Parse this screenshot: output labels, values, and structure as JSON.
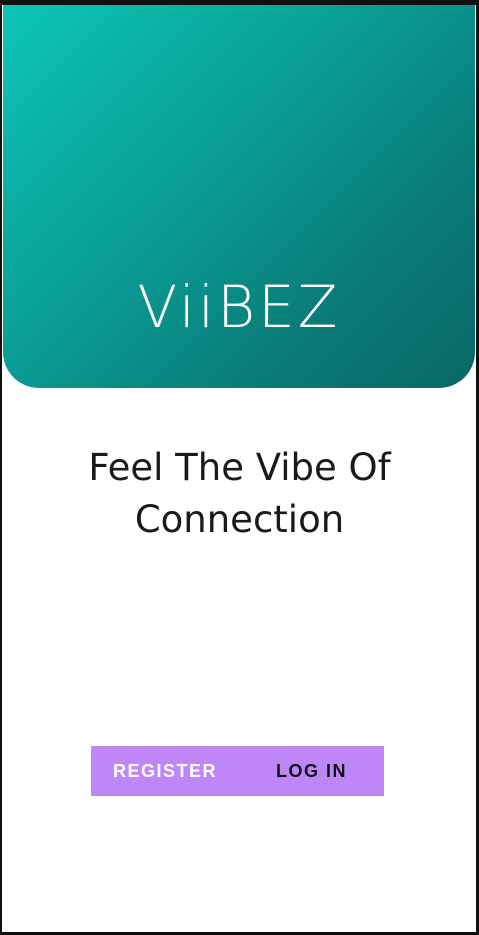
{
  "app": {
    "logo_text": "ViiBEZ",
    "brand_color_start": "#0cc6b4",
    "brand_color_end": "#086866"
  },
  "main": {
    "tagline": "Feel The Vibe Of Connection"
  },
  "actions": {
    "register_label": "REGISTER",
    "login_label": "LOG IN",
    "bar_color": "#bf86f7"
  }
}
